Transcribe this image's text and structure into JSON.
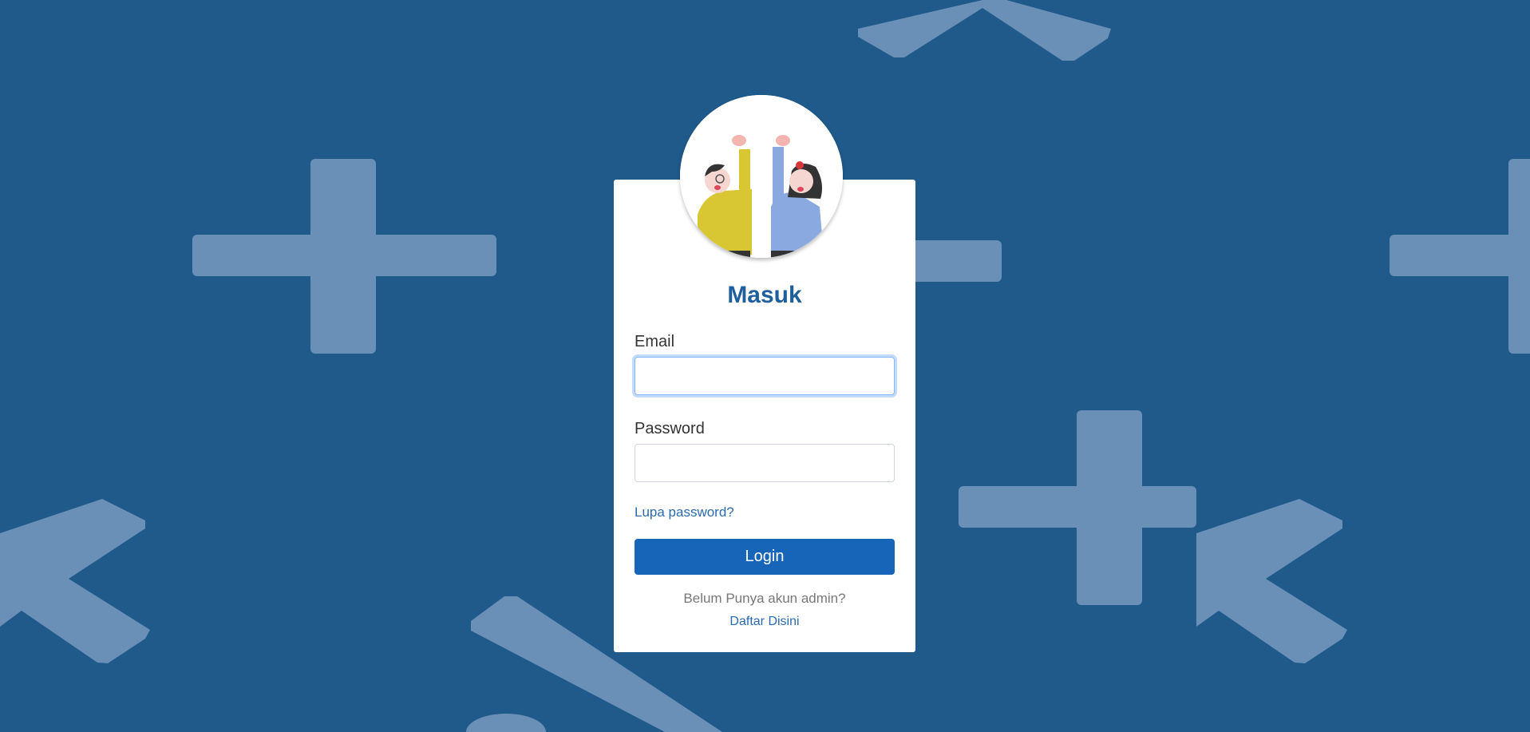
{
  "colors": {
    "background": "#1f5a8b",
    "shape": "#6a90b8",
    "accent": "#1765b8",
    "title": "#1f5f9c"
  },
  "avatar": {
    "icon": "two-people-cheering-illustration"
  },
  "form": {
    "title": "Masuk",
    "email_label": "Email",
    "email_value": "",
    "password_label": "Password",
    "password_value": "",
    "forgot_link": "Lupa password?",
    "login_button": "Login",
    "no_account_text": "Belum Punya akun admin?",
    "register_link": "Daftar Disini"
  }
}
